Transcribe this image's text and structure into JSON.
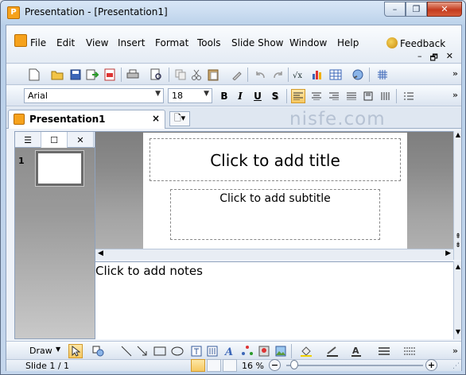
{
  "window": {
    "title": "Presentation - [Presentation1]",
    "app_icon_letter": "P",
    "controls": {
      "minimize": "–",
      "restore": "❐",
      "close": "✕"
    }
  },
  "menubar": {
    "items": [
      "File",
      "Edit",
      "View",
      "Insert",
      "Format",
      "Tools",
      "Slide Show",
      "Window",
      "Help"
    ],
    "feedback": "Feedback",
    "mdi": {
      "minimize": "–",
      "restore": "🗗",
      "close": "✕"
    }
  },
  "toolbar_standard": {
    "overflow": "»"
  },
  "toolbar_format": {
    "font_name": "Arial",
    "font_size": "18",
    "bold": "B",
    "italic": "I",
    "underline": "U",
    "shadow": "S",
    "overflow": "»"
  },
  "tabs": {
    "active_doc": "Presentation1",
    "close": "×"
  },
  "watermark": "nisfe.com",
  "slide_panel": {
    "tab_icons": [
      "☰",
      "☐",
      "✕"
    ],
    "slide_number": "1"
  },
  "slide": {
    "title_placeholder": "Click to add title",
    "subtitle_placeholder": "Click to add subtitle"
  },
  "notes": {
    "placeholder": "Click to add notes"
  },
  "drawbar": {
    "label": "Draw"
  },
  "statusbar": {
    "slide_info": "Slide 1 / 1",
    "zoom": "16 %",
    "zoom_minus": "−",
    "zoom_plus": "+"
  },
  "colors": {
    "accent_orange": "#f6a21c",
    "titlebar_blue": "#bcd2ea",
    "close_red": "#c43b1f",
    "active_button": "#f6c861"
  }
}
